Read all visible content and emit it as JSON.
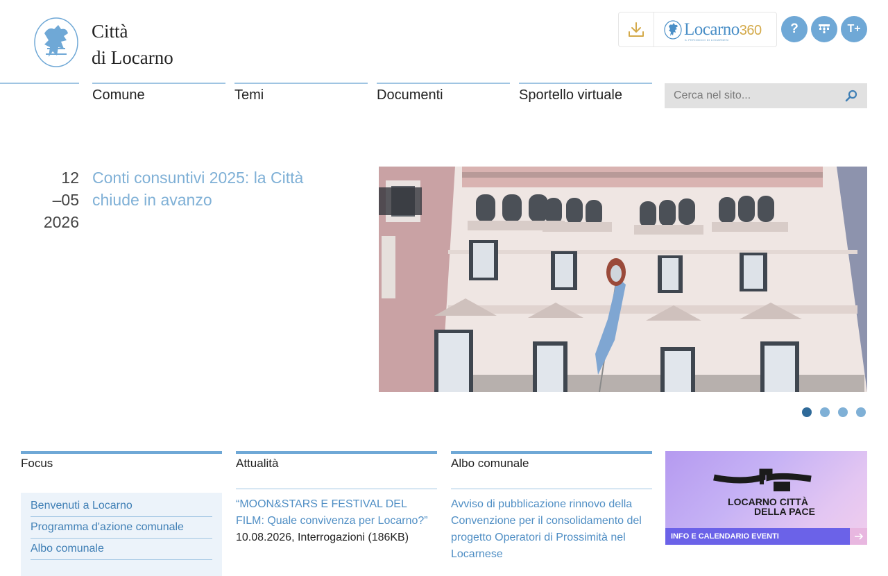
{
  "header": {
    "logo_line1": "Città",
    "logo_line2": "di Locarno",
    "locarno360_word": "Locarno",
    "locarno360_num": "360",
    "locarno360_sub": "IL PERIODICO DI LOCARNESI",
    "help_label": "?",
    "text_size_label": "T+"
  },
  "nav": {
    "items": [
      "Comune",
      "Temi",
      "Documenti",
      "Sportello virtuale"
    ],
    "search_placeholder": "Cerca nel sito..."
  },
  "hero": {
    "date_day": "12",
    "date_month": "–05",
    "date_year": "2026",
    "title": "Conti consuntivi 2025: la Città chiude in avanzo",
    "slides_total": 4,
    "slide_active": 1
  },
  "columns": {
    "focus": {
      "title": "Focus",
      "items": [
        "Benvenuti a Locarno",
        "Programma d'azione comunale",
        "Albo comunale"
      ]
    },
    "attualita": {
      "title": "Attualità",
      "item_title": "“MOON&STARS E FESTIVAL DEL FILM: Quale convivenza per Locarno?”",
      "item_meta": "10.08.2026, Interrogazioni (186KB)"
    },
    "albo": {
      "title": "Albo comunale",
      "item_title": "Avviso di pubblicazione rinnovo della Convenzione per il consolidamento del progetto Operatori di Prossimità nel Locarnese"
    }
  },
  "promo": {
    "line1": "LOCARNO CITTÀ",
    "line2": "DELLA PACE",
    "footer": "INFO E CALENDARIO EVENTI"
  },
  "colors": {
    "accent": "#6fa8d6",
    "link": "#4f8ec4",
    "gold": "#d4aa4a",
    "promo_footer": "#6b62e8"
  },
  "icons": [
    "download-icon",
    "lion-emblem",
    "help-icon",
    "sitemap-icon",
    "text-size-icon",
    "search-icon",
    "arrow-right-icon"
  ]
}
